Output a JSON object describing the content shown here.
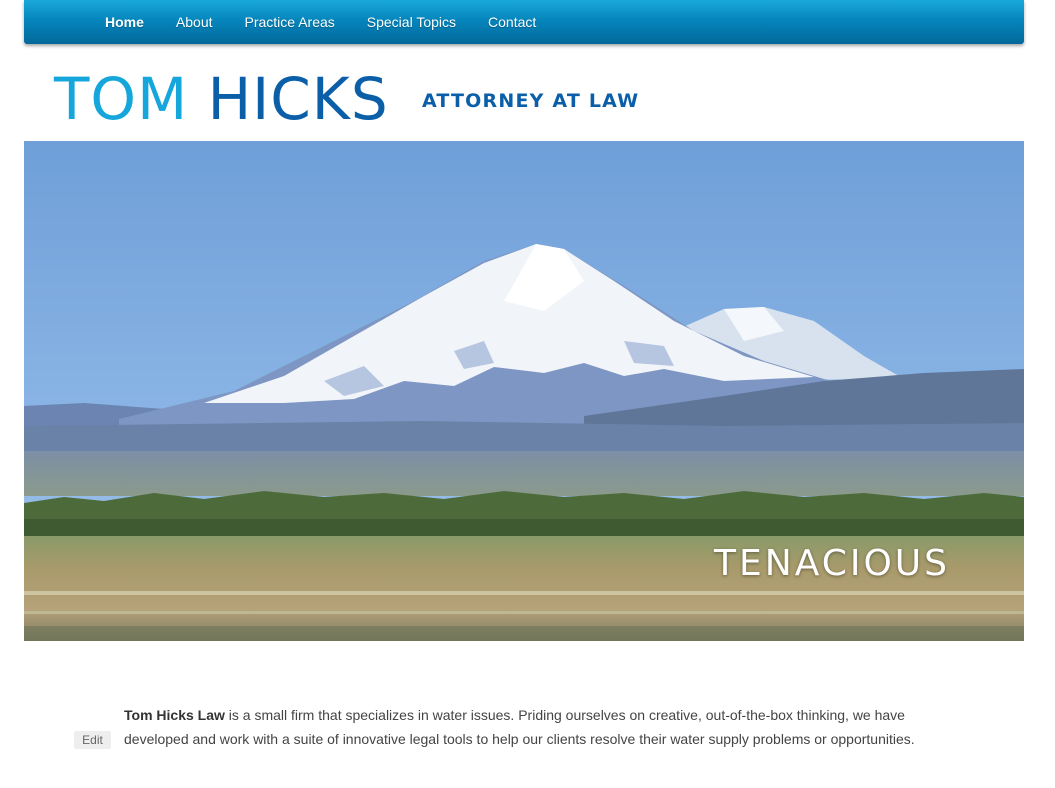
{
  "nav": {
    "items": [
      {
        "label": "Home",
        "active": true
      },
      {
        "label": "About",
        "active": false
      },
      {
        "label": "Practice Areas",
        "active": false
      },
      {
        "label": "Special Topics",
        "active": false
      },
      {
        "label": "Contact",
        "active": false
      }
    ]
  },
  "header": {
    "logo_first": "TOM",
    "logo_last": "HICKS",
    "tagline": "ATTORNEY AT LAW"
  },
  "hero": {
    "caption": "TENACIOUS"
  },
  "main": {
    "edit_label": "Edit",
    "intro_bold": "Tom Hicks Law",
    "intro_text": " is a small firm that specializes in water issues. Priding ourselves on creative, out-of-the-box thinking, we have developed and work with a suite of innovative legal tools to help our clients resolve their water supply problems or opportunities."
  },
  "colors": {
    "nav_top": "#1aa8d9",
    "nav_bottom": "#04689a",
    "logo_light_blue": "#15a6dc",
    "logo_dark_blue": "#0b5fa8"
  }
}
